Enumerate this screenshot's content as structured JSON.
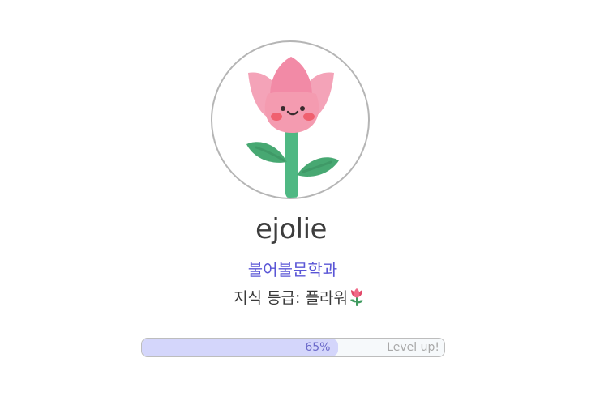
{
  "profile": {
    "username": "ejolie",
    "department": "불어불문학과",
    "grade_label": "지식 등급: 플라워",
    "grade_icon": "tulip-icon",
    "avatar_icon": "tulip-character-icon"
  },
  "progress": {
    "percent": 65,
    "percent_label": "65%",
    "level_up_label": "Level up!"
  },
  "colors": {
    "department_text": "#5a56d6",
    "progress_fill": "#d4d6fb",
    "progress_text": "#6b69c9",
    "tulip_pink": "#f28aa6",
    "stem_green": "#4fb883"
  }
}
